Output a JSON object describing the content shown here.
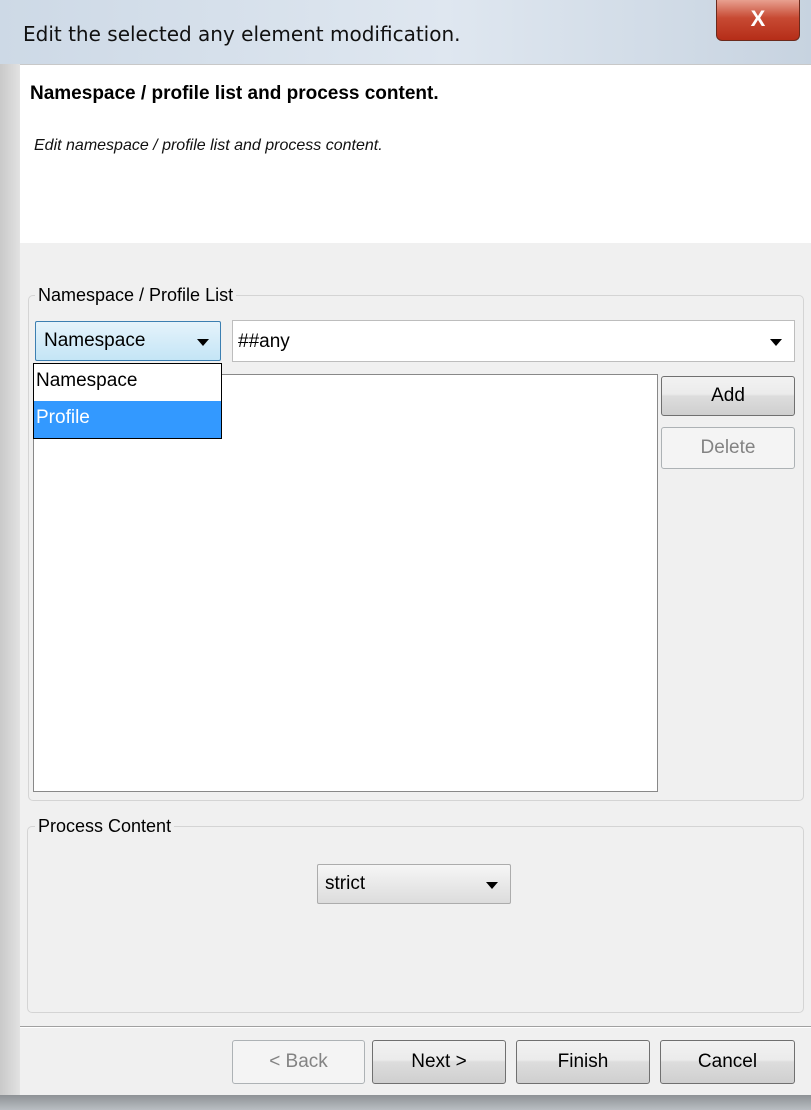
{
  "window": {
    "title": "Edit the selected any element modification.",
    "close_label": "X"
  },
  "header": {
    "title": "Namespace / profile list and process content.",
    "subtitle": "Edit namespace / profile list and process content."
  },
  "namespace_profile_list": {
    "legend": "Namespace / Profile List",
    "type_combo": {
      "selected": "Namespace",
      "arrow_icon": "triangle-down-icon"
    },
    "type_dropdown_options": [
      "Namespace",
      "Profile"
    ],
    "type_dropdown_highlighted": "Profile",
    "namespace_combo": {
      "value": "##any",
      "arrow_icon": "triangle-down-icon"
    },
    "list_items": [],
    "add_label": "Add",
    "delete_label": "Delete"
  },
  "process_content": {
    "legend": "Process Content",
    "selected": "strict",
    "arrow_icon": "triangle-down-icon"
  },
  "footer": {
    "back_label": "< Back",
    "next_label": "Next >",
    "finish_label": "Finish",
    "cancel_label": "Cancel"
  },
  "colors": {
    "selection": "#3399ff",
    "close_button": "#c74a33",
    "header_background": "#ffffff",
    "dialog_background": "#f0f0f0"
  }
}
